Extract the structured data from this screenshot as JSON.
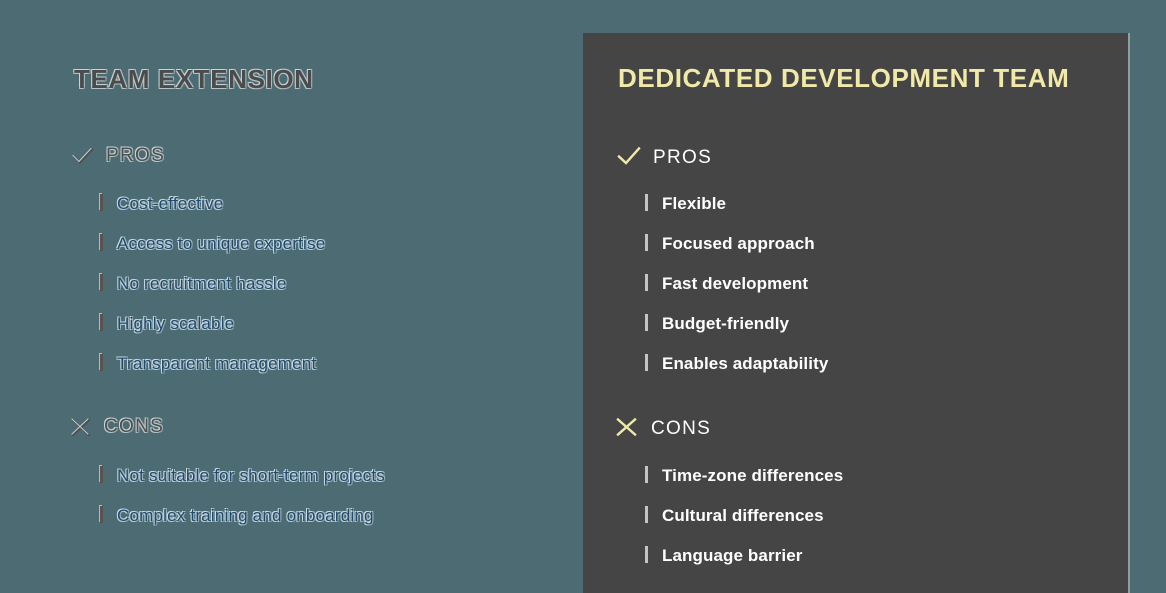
{
  "colors": {
    "page_background": "#4c6b72",
    "card_background": "#454545",
    "accent_yellow": "#f0e9a8",
    "left_text_blue": "#21496b",
    "left_heading_gray": "#4b4b4b",
    "right_text_white": "#ffffff"
  },
  "left_panel": {
    "title": "TEAM EXTENSION",
    "pros": {
      "icon": "check-icon",
      "label": "PROS",
      "items": [
        "Cost-effective",
        "Access to unique expertise",
        "No recruitment hassle",
        "Highly scalable",
        "Transparent management"
      ]
    },
    "cons": {
      "icon": "cross-icon",
      "label": "CONS",
      "items": [
        "Not suitable for short-term projects",
        "Complex training and onboarding"
      ]
    }
  },
  "right_panel": {
    "title": "DEDICATED DEVELOPMENT TEAM",
    "pros": {
      "icon": "check-icon",
      "label": "PROS",
      "items": [
        "Flexible",
        "Focused approach",
        "Fast development",
        "Budget-friendly",
        "Enables adaptability"
      ]
    },
    "cons": {
      "icon": "cross-icon",
      "label": "CONS",
      "items": [
        "Time-zone differences",
        "Cultural differences",
        "Language barrier"
      ]
    }
  }
}
